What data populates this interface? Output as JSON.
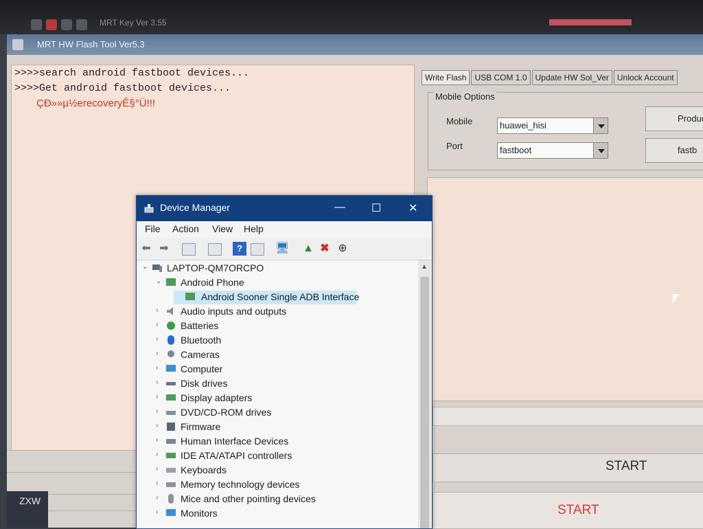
{
  "taskbar": {
    "app_title": "MRT Key Ver 3.55"
  },
  "mrt": {
    "title": "MRT HW Flash Tool Ver5.3",
    "log_lines": [
      ">>>>search android fastboot devices...",
      ">>>>Get android fastboot devices...",
      "ÇÐ»»µ½erecoveryÊ§°Ü!!!"
    ],
    "tabs": [
      "Write Flash",
      "USB COM 1.0",
      "Update HW Sol_Ver",
      "Unlock Account"
    ],
    "mobile_options": {
      "legend": "Mobile Options",
      "mobile_label": "Mobile",
      "mobile_value": "huawei_hisi",
      "port_label": "Port",
      "port_value": "fastboot",
      "button1_label": "Produc",
      "button2_label": "fastb"
    },
    "start_label_1": "START",
    "start_label_2": "START",
    "bottom_left_label": "ZXW",
    "colors": {
      "error_text": "#c0392b",
      "title_bar": "#6f86a4",
      "log_bg": "#f6e2d6"
    }
  },
  "device_manager": {
    "title": "Device Manager",
    "menu": [
      "File",
      "Action",
      "View",
      "Help"
    ],
    "computer_name": "LAPTOP-QM7ORCPO",
    "expanded_category": "Android Phone",
    "selected_device": "Android Sooner Single ADB Interface",
    "categories": [
      "Audio inputs and outputs",
      "Batteries",
      "Bluetooth",
      "Cameras",
      "Computer",
      "Disk drives",
      "Display adapters",
      "DVD/CD-ROM drives",
      "Firmware",
      "Human Interface Devices",
      "IDE ATA/ATAPI controllers",
      "Keyboards",
      "Memory technology devices",
      "Mice and other pointing devices",
      "Monitors"
    ],
    "colors": {
      "title_bar": "#12407f",
      "selection": "#cce8f7"
    }
  }
}
